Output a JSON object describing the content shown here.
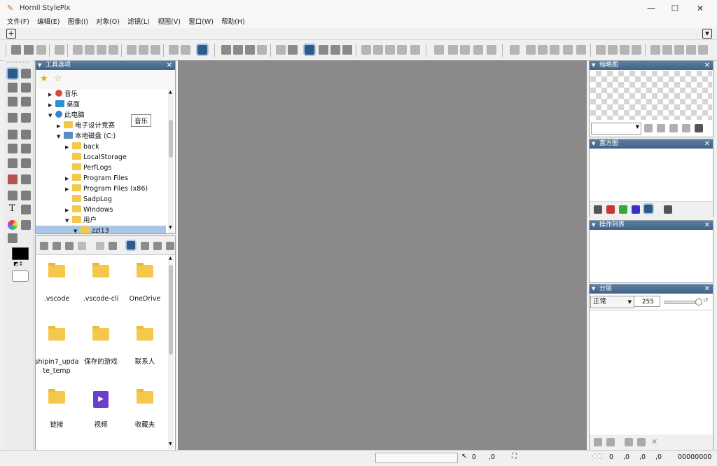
{
  "window": {
    "title": "Hornil StylePix",
    "minimize": "—",
    "maximize": "☐",
    "close": "✕"
  },
  "menu": [
    "文件(F)",
    "编辑(E)",
    "图像(I)",
    "对象(O)",
    "滤镜(L)",
    "视图(V)",
    "窗口(W)",
    "帮助(H)"
  ],
  "tool_options": {
    "title": "工具选项",
    "tree": [
      {
        "label": "音乐",
        "indent": 1,
        "arrow": "▶",
        "icon": "music"
      },
      {
        "label": "桌面",
        "indent": 1,
        "arrow": "▶",
        "icon": "desktop"
      },
      {
        "label": "此电脑",
        "indent": 1,
        "arrow": "▼",
        "icon": "pc"
      },
      {
        "label": "电子设计竞赛",
        "indent": 2,
        "arrow": "▶",
        "icon": "folder"
      },
      {
        "label": "本地磁盘 (C:)",
        "indent": 2,
        "arrow": "▼",
        "icon": "drive"
      },
      {
        "label": "back",
        "indent": 3,
        "arrow": "▶",
        "icon": "folder"
      },
      {
        "label": "LocalStorage",
        "indent": 3,
        "arrow": "",
        "icon": "folder"
      },
      {
        "label": "PerfLogs",
        "indent": 3,
        "arrow": "",
        "icon": "folder"
      },
      {
        "label": "Program Files",
        "indent": 3,
        "arrow": "▶",
        "icon": "folder"
      },
      {
        "label": "Program Files (x86)",
        "indent": 3,
        "arrow": "▶",
        "icon": "folder"
      },
      {
        "label": "SadpLog",
        "indent": 3,
        "arrow": "",
        "icon": "folder"
      },
      {
        "label": "Windows",
        "indent": 3,
        "arrow": "▶",
        "icon": "folder"
      },
      {
        "label": "用户",
        "indent": 3,
        "arrow": "▼",
        "icon": "folder"
      },
      {
        "label": "zzl13",
        "indent": 4,
        "arrow": "▼",
        "icon": "folder",
        "selected": true
      }
    ],
    "tooltip": "音乐"
  },
  "files": [
    {
      "name": "vscode_a",
      "label": ".vscode",
      "kind": "folder"
    },
    {
      "name": "vscode_b",
      "label": ".vscode-cli",
      "kind": "folder"
    },
    {
      "name": "onedrive",
      "label": "OneDrive",
      "kind": "folder"
    },
    {
      "name": "shipin",
      "label": "shipin7_update_temp",
      "kind": "folder"
    },
    {
      "name": "games",
      "label": "保存的游戏",
      "kind": "folder"
    },
    {
      "name": "contacts",
      "label": "联系人",
      "kind": "folder"
    },
    {
      "name": "links",
      "label": "链接",
      "kind": "folder"
    },
    {
      "name": "videos",
      "label": "视频",
      "kind": "video"
    },
    {
      "name": "favorites",
      "label": "收藏夹",
      "kind": "folder"
    }
  ],
  "panels": {
    "thumbnail": "缩略图",
    "histogram": "直方图",
    "history": "操作列表",
    "layers": "分层"
  },
  "layers": {
    "blend_mode": "正常",
    "opacity": "255"
  },
  "status": {
    "cursor_x": "0",
    "cursor_y": ",0",
    "sel_x": "0",
    "sel_y": ",0",
    "sel_w": ",0",
    "sel_h": ",0",
    "color_value": "00000000"
  },
  "colors": {
    "header": "#4a6c92",
    "canvas": "#8a8a8a",
    "folder": "#f3c94a",
    "selected": "#aac6e4"
  }
}
